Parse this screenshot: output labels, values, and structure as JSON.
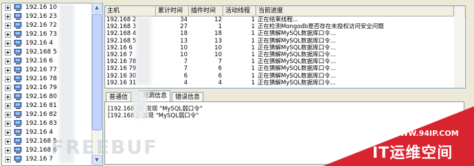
{
  "tree": {
    "items": [
      {
        "ip_prefix": "192.16",
        "ip_suffix": "10"
      },
      {
        "ip_prefix": "192.16",
        "ip_suffix": "23"
      },
      {
        "ip_prefix": "192.16",
        "ip_suffix": "72"
      },
      {
        "ip_prefix": "192.16",
        "ip_suffix": "73"
      },
      {
        "ip_prefix": "192.16",
        "ip_suffix": "4"
      },
      {
        "ip_prefix": "192.168",
        "ip_suffix": "5"
      },
      {
        "ip_prefix": "192.16",
        "ip_suffix": "6"
      },
      {
        "ip_prefix": "192.16",
        "ip_suffix": "77"
      },
      {
        "ip_prefix": "192.16",
        "ip_suffix": "78"
      },
      {
        "ip_prefix": "192.16",
        "ip_suffix": "79"
      },
      {
        "ip_prefix": "192.16",
        "ip_suffix": "80"
      },
      {
        "ip_prefix": "192.16",
        "ip_suffix": "81"
      },
      {
        "ip_prefix": "192.16",
        "ip_suffix": "82"
      },
      {
        "ip_prefix": "192.16",
        "ip_suffix": "83"
      },
      {
        "ip_prefix": "192.16",
        "ip_suffix": "4"
      },
      {
        "ip_prefix": "192.168",
        "ip_suffix": "5"
      },
      {
        "ip_prefix": "192.168",
        "ip_suffix": "6"
      },
      {
        "ip_prefix": "192.16",
        "ip_suffix": "7"
      }
    ]
  },
  "grid": {
    "headers": [
      "主机",
      "累计时间",
      "插件时间",
      "活动线程",
      "当前进度"
    ],
    "rows": [
      {
        "host": "192.168",
        "suffix": "2",
        "total": "34",
        "plugin": "12",
        "threads": "1",
        "progress": "正在结束线程..."
      },
      {
        "host": "192.168",
        "suffix": "3",
        "total": "27",
        "plugin": "1",
        "threads": "1",
        "progress": "正在检测Mongodb是否存在未授权访问安全问题"
      },
      {
        "host": "192.168",
        "suffix": "4",
        "total": "18",
        "plugin": "18",
        "threads": "1",
        "progress": "正在猜解MySQL数据库口令..."
      },
      {
        "host": "192.168",
        "suffix": "5",
        "total": "13",
        "plugin": "13",
        "threads": "1",
        "progress": "正在猜解MySQL数据库口令..."
      },
      {
        "host": "192.16",
        "suffix": "6",
        "total": "10",
        "plugin": "10",
        "threads": "1",
        "progress": "正在猜解MySQL数据库口令..."
      },
      {
        "host": "192.16",
        "suffix": "7",
        "total": "10",
        "plugin": "10",
        "threads": "1",
        "progress": "正在猜解MySQL数据库口令..."
      },
      {
        "host": "192.16",
        "suffix": "78",
        "total": "7",
        "plugin": "7",
        "threads": "1",
        "progress": "正在猜解MySQL数据库口令..."
      },
      {
        "host": "192.16",
        "suffix": "79",
        "total": "7",
        "plugin": "6",
        "threads": "1",
        "progress": "正在猜解MySQL数据库口令..."
      },
      {
        "host": "192.16",
        "suffix": "30",
        "total": "6",
        "plugin": "6",
        "threads": "1",
        "progress": "正在猜解MySQL数据库口令..."
      },
      {
        "host": "192.16",
        "suffix": "31",
        "total": "4",
        "plugin": "4",
        "threads": "1",
        "progress": "正在猜解MySQL数据库口令..."
      }
    ]
  },
  "tabs": [
    "普通信",
    "漏洞信息",
    "错误信息"
  ],
  "log": [
    "[192.168          0]: 发现 \"MySQL弱口令\"",
    "[192.168          ]: 发现 \"MySQL弱口令\""
  ],
  "watermark": {
    "freebuf": "FREEBUF",
    "url": "WWW.94IP.COM",
    "brand": "IT运维空间"
  },
  "colors": {
    "corner_red": "#d9232e",
    "selection_blue": "#316ac5"
  }
}
